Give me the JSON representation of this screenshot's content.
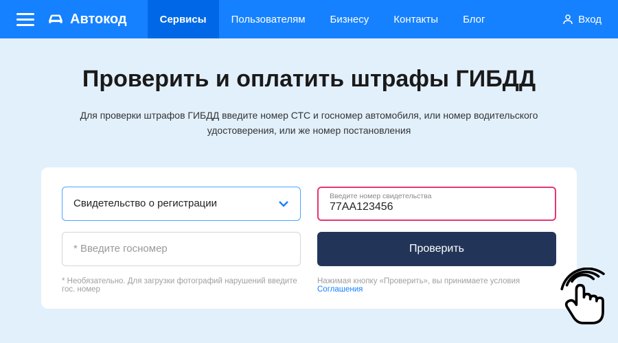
{
  "header": {
    "brand": "Автокод",
    "nav": [
      {
        "label": "Сервисы",
        "active": true
      },
      {
        "label": "Пользователям",
        "active": false
      },
      {
        "label": "Бизнесу",
        "active": false
      },
      {
        "label": "Контакты",
        "active": false
      },
      {
        "label": "Блог",
        "active": false
      }
    ],
    "login_label": "Вход"
  },
  "page": {
    "title": "Проверить и оплатить штрафы ГИБДД",
    "subtitle": "Для проверки штрафов ГИБДД введите номер СТС и госномер автомобиля, или номер водительского удостоверения, или же номер постановления"
  },
  "form": {
    "doc_type_label": "Свидетельство о регистрации",
    "cert_float_label": "Введите номер свидетельства",
    "cert_value": "77АА123456",
    "plate_placeholder": "* Введите госномер",
    "check_button": "Проверить",
    "hint": "* Необязательно. Для загрузки фотографий нарушений введите гос. номер",
    "agreement_prefix": "Нажимая кнопку «Проверить», вы принимаете условия ",
    "agreement_link": "Соглашения"
  }
}
